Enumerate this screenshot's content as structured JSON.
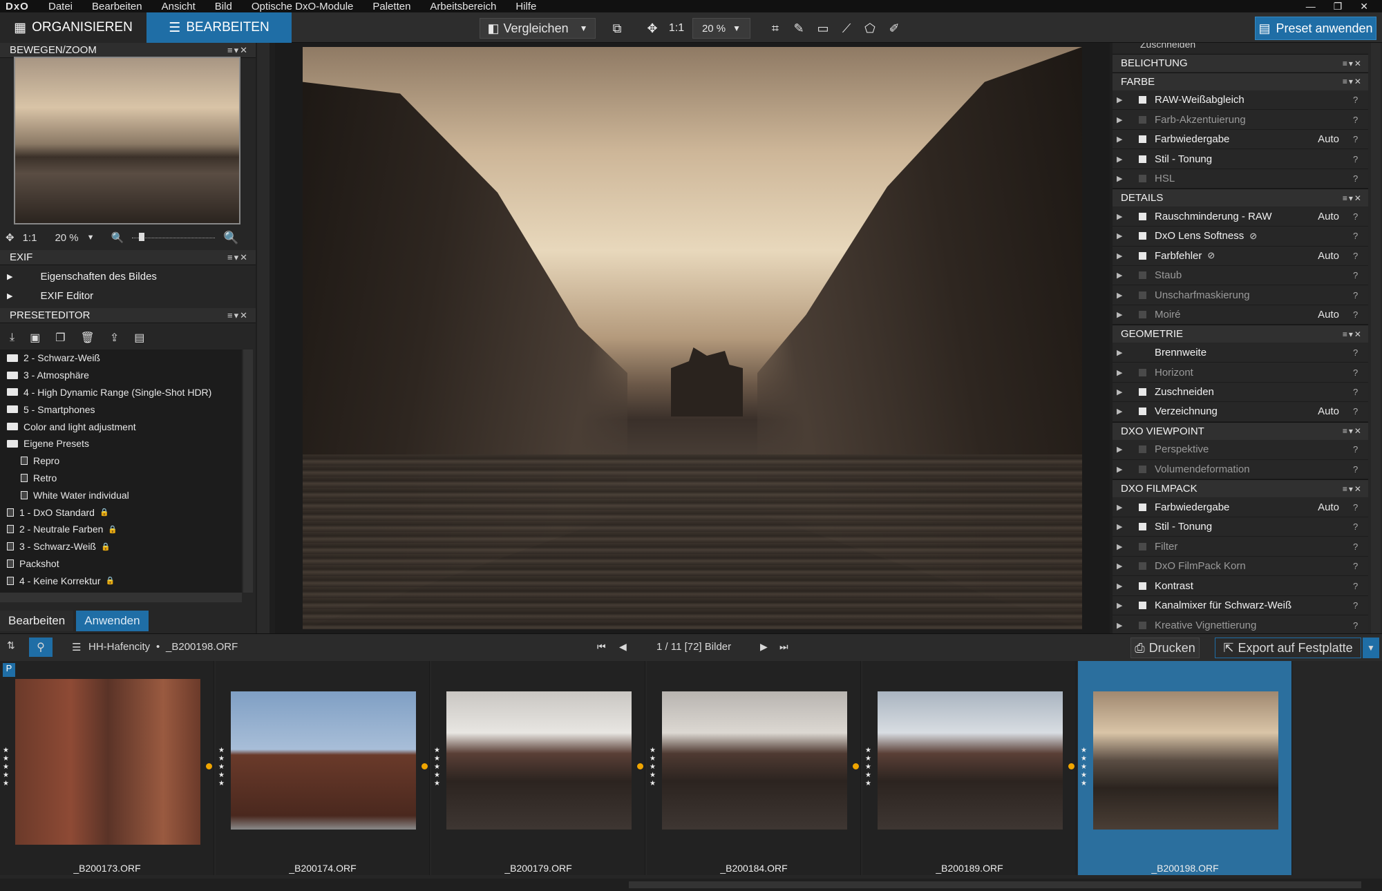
{
  "menubar": {
    "logo": "DxO",
    "items": [
      "Datei",
      "Bearbeiten",
      "Ansicht",
      "Bild",
      "Optische DxO-Module",
      "Paletten",
      "Arbeitsbereich",
      "Hilfe"
    ]
  },
  "toolbar": {
    "tab_organize": "ORGANISIEREN",
    "tab_edit": "BEARBEITEN",
    "compare": "Vergleichen",
    "ratio": "1:1",
    "zoom": "20 %",
    "preset_apply": "Preset anwenden"
  },
  "left": {
    "navigator_title": "BEWEGEN/ZOOM",
    "nav_ratio": "1:1",
    "nav_zoom": "20 %",
    "exif_title": "EXIF",
    "exif_items": [
      "Eigenschaften des Bildes",
      "EXIF Editor"
    ],
    "preset_editor_title": "PRESETEDITOR",
    "presets": [
      {
        "label": "2 - Schwarz-Weiß",
        "type": "folder",
        "indent": 0
      },
      {
        "label": "3 - Atmosphäre",
        "type": "folder",
        "indent": 0
      },
      {
        "label": "4 - High Dynamic Range (Single-Shot HDR)",
        "type": "folder",
        "indent": 0
      },
      {
        "label": "5 - Smartphones",
        "type": "folder",
        "indent": 0
      },
      {
        "label": "Color and light adjustment",
        "type": "folder",
        "indent": 0
      },
      {
        "label": "Eigene Presets",
        "type": "folder",
        "indent": 0
      },
      {
        "label": "Repro",
        "type": "doc",
        "indent": 1
      },
      {
        "label": "Retro",
        "type": "doc",
        "indent": 1
      },
      {
        "label": "White Water individual",
        "type": "doc",
        "indent": 1
      },
      {
        "label": "1 - DxO Standard",
        "type": "doc",
        "indent": 0,
        "locked": true
      },
      {
        "label": "2 - Neutrale Farben",
        "type": "doc",
        "indent": 0,
        "locked": true
      },
      {
        "label": "3 - Schwarz-Weiß",
        "type": "doc",
        "indent": 0,
        "locked": true
      },
      {
        "label": "Packshot",
        "type": "doc",
        "indent": 0
      },
      {
        "label": "4 - Keine Korrektur",
        "type": "doc",
        "indent": 0,
        "locked": true
      }
    ],
    "bottom_tabs": [
      "Bearbeiten",
      "Anwenden"
    ]
  },
  "right": {
    "top_cut": "Zuschneiden",
    "sections": [
      {
        "title": "BELICHTUNG",
        "rows": []
      },
      {
        "title": "FARBE",
        "rows": [
          {
            "name": "RAW-Weißabgleich",
            "state": "on",
            "auto": ""
          },
          {
            "name": "Farb-Akzentuierung",
            "state": "off",
            "auto": ""
          },
          {
            "name": "Farbwiedergabe",
            "state": "on",
            "auto": "Auto"
          },
          {
            "name": "Stil - Tonung",
            "state": "on",
            "auto": ""
          },
          {
            "name": "HSL",
            "state": "off",
            "auto": ""
          }
        ]
      },
      {
        "title": "DETAILS",
        "rows": [
          {
            "name": "Rauschminderung - RAW",
            "state": "on",
            "auto": "Auto"
          },
          {
            "name": "DxO Lens Softness",
            "state": "on",
            "auto": "",
            "eye": true
          },
          {
            "name": "Farbfehler",
            "state": "on",
            "auto": "Auto",
            "eye": true
          },
          {
            "name": "Staub",
            "state": "off",
            "auto": ""
          },
          {
            "name": "Unscharfmaskierung",
            "state": "off",
            "auto": ""
          },
          {
            "name": "Moiré",
            "state": "off",
            "auto": "Auto"
          }
        ]
      },
      {
        "title": "GEOMETRIE",
        "rows": [
          {
            "name": "Brennweite",
            "state": "none",
            "auto": ""
          },
          {
            "name": "Horizont",
            "state": "off",
            "auto": ""
          },
          {
            "name": "Zuschneiden",
            "state": "on",
            "auto": ""
          },
          {
            "name": "Verzeichnung",
            "state": "on",
            "auto": "Auto"
          }
        ]
      },
      {
        "title": "DXO VIEWPOINT",
        "rows": [
          {
            "name": "Perspektive",
            "state": "off",
            "auto": ""
          },
          {
            "name": "Volumendeformation",
            "state": "off",
            "auto": ""
          }
        ]
      },
      {
        "title": "DXO FILMPACK",
        "rows": [
          {
            "name": "Farbwiedergabe",
            "state": "on",
            "auto": "Auto"
          },
          {
            "name": "Stil - Tonung",
            "state": "on",
            "auto": ""
          },
          {
            "name": "Filter",
            "state": "off",
            "auto": ""
          },
          {
            "name": "DxO FilmPack Korn",
            "state": "off",
            "auto": ""
          },
          {
            "name": "Kontrast",
            "state": "on",
            "auto": ""
          },
          {
            "name": "Kanalmixer für Schwarz-Weiß",
            "state": "on",
            "auto": ""
          },
          {
            "name": "Kreative Vignettierung",
            "state": "off",
            "auto": ""
          }
        ]
      }
    ]
  },
  "status": {
    "folder": "HH-Hafencity",
    "file": "_B200198.ORF",
    "separator": "•",
    "counter": "1 / 11 [72] Bilder",
    "print": "Drucken",
    "export": "Export auf Festplatte"
  },
  "filmstrip": [
    {
      "file": "_B200173.ORF",
      "selected": false
    },
    {
      "file": "_B200174.ORF",
      "selected": false
    },
    {
      "file": "_B200179.ORF",
      "selected": false
    },
    {
      "file": "_B200184.ORF",
      "selected": false
    },
    {
      "file": "_B200189.ORF",
      "selected": false
    },
    {
      "file": "_B200198.ORF",
      "selected": true
    }
  ],
  "colors": {
    "accent": "#1f6ea6",
    "panel": "#262626",
    "rating_dot": "#f0a500"
  }
}
